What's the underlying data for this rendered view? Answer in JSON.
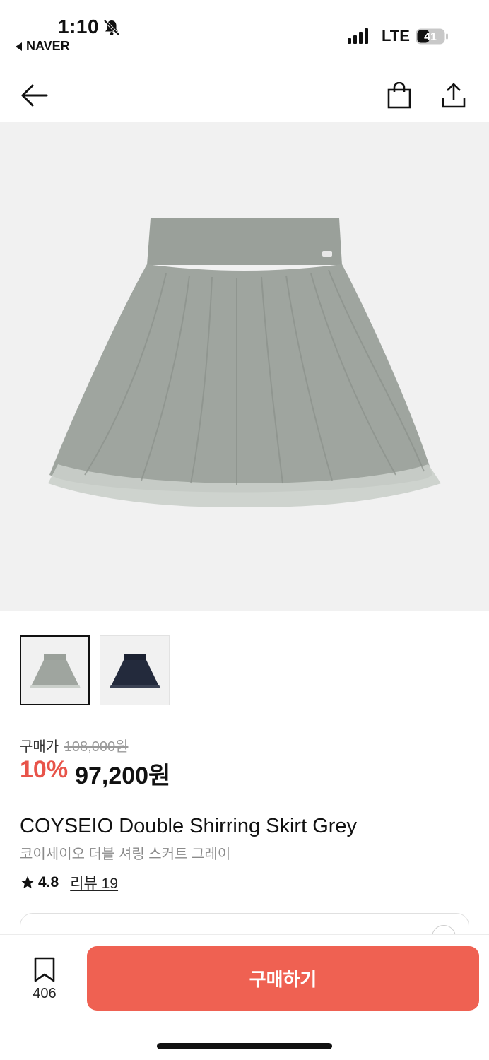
{
  "status_bar": {
    "time": "1:10",
    "back_app": "NAVER",
    "network": "LTE",
    "battery": "41",
    "icons": [
      "bell-slash-icon",
      "signal-icon",
      "battery-icon"
    ]
  },
  "nav": {
    "icons": [
      "back-arrow-icon",
      "shopping-bag-icon",
      "share-icon"
    ]
  },
  "product": {
    "price_label": "구매가",
    "original_price": "108,000원",
    "discount": "10%",
    "sale_price": "97,200원",
    "name": "COYSEIO Double Shirring Skirt Grey",
    "name_korean": "코이세이오 더블 셔링 스커트 그레이",
    "rating": "4.8",
    "review_link": "리뷰 19"
  },
  "thumbnails": [
    {
      "color": "#9aa099",
      "selected": true
    },
    {
      "color": "#1c2232",
      "selected": false
    }
  ],
  "bottom_bar": {
    "wishlist_count": "406",
    "buy_label": "구매하기"
  },
  "colors": {
    "accent": "#ef6152",
    "discount": "#e8544a",
    "skirt_grey": "#9aa099",
    "skirt_navy": "#1c2232"
  }
}
